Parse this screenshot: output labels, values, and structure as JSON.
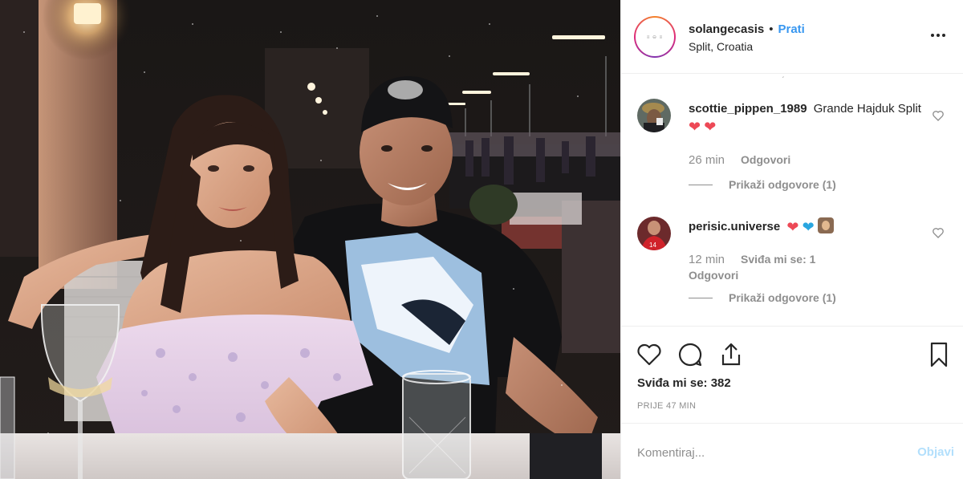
{
  "post": {
    "username": "solangecasis",
    "separator": "•",
    "follow_label": "Prati",
    "location": "Split, Croatia",
    "avatar_text": "≡ ⊖ ≡",
    "more_icon": "more-horizontal-icon"
  },
  "comments": [
    {
      "username": "scottie_pippen_1989",
      "text": "Grande Hajduk Split",
      "emoji": [
        "red-heart",
        "red-heart"
      ],
      "time": "26 min",
      "reply_label": "Odgovori",
      "view_replies": "Prikaži odgovore (1)"
    },
    {
      "username": "perisic.universe",
      "text": "",
      "emoji": [
        "red-heart",
        "blue-heart",
        "face-in-hands"
      ],
      "time": "12 min",
      "likes": "Sviđa mi se: 1",
      "reply_label": "Odgovori",
      "view_replies": "Prikaži odgovore (1)"
    }
  ],
  "actions": {
    "icons": [
      "heart-icon",
      "comment-icon",
      "share-icon",
      "bookmark-icon"
    ],
    "likes_text": "Sviđa mi se: 382",
    "timestamp": "PRIJE 47 MIN"
  },
  "add_comment": {
    "placeholder": "Komentiraj...",
    "post_label": "Objavi"
  },
  "colors": {
    "link_blue": "#3897f0",
    "post_disabled": "#b2dffc",
    "heart_red": "#ed4956",
    "heart_blue": "#29a6e0",
    "text_dark": "#262626",
    "text_muted": "#8e8e8e"
  }
}
